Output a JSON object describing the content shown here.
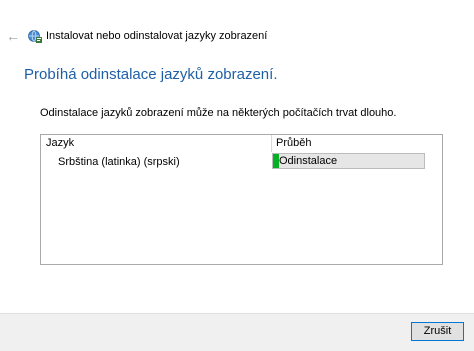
{
  "window": {
    "title": "Instalovat nebo odinstalovat jazyky zobrazení",
    "back_icon": "arrow-left-icon",
    "app_icon": "globe-language-icon"
  },
  "main": {
    "heading": "Probíhá odinstalace jazyků zobrazení.",
    "intro": "Odinstalace jazyků zobrazení může na některých počítačích trvat dlouho."
  },
  "table": {
    "headers": [
      "Jazyk",
      "Průběh"
    ],
    "rows": [
      {
        "language": "Srbština (latinka) (srpski)",
        "status": "Odinstalace",
        "progress": 0.04
      }
    ]
  },
  "footer": {
    "cancel_label": "Zrušit"
  },
  "colors": {
    "accent": "#1f5fa8",
    "progress": "#06b025",
    "focus_border": "#0078d7"
  }
}
